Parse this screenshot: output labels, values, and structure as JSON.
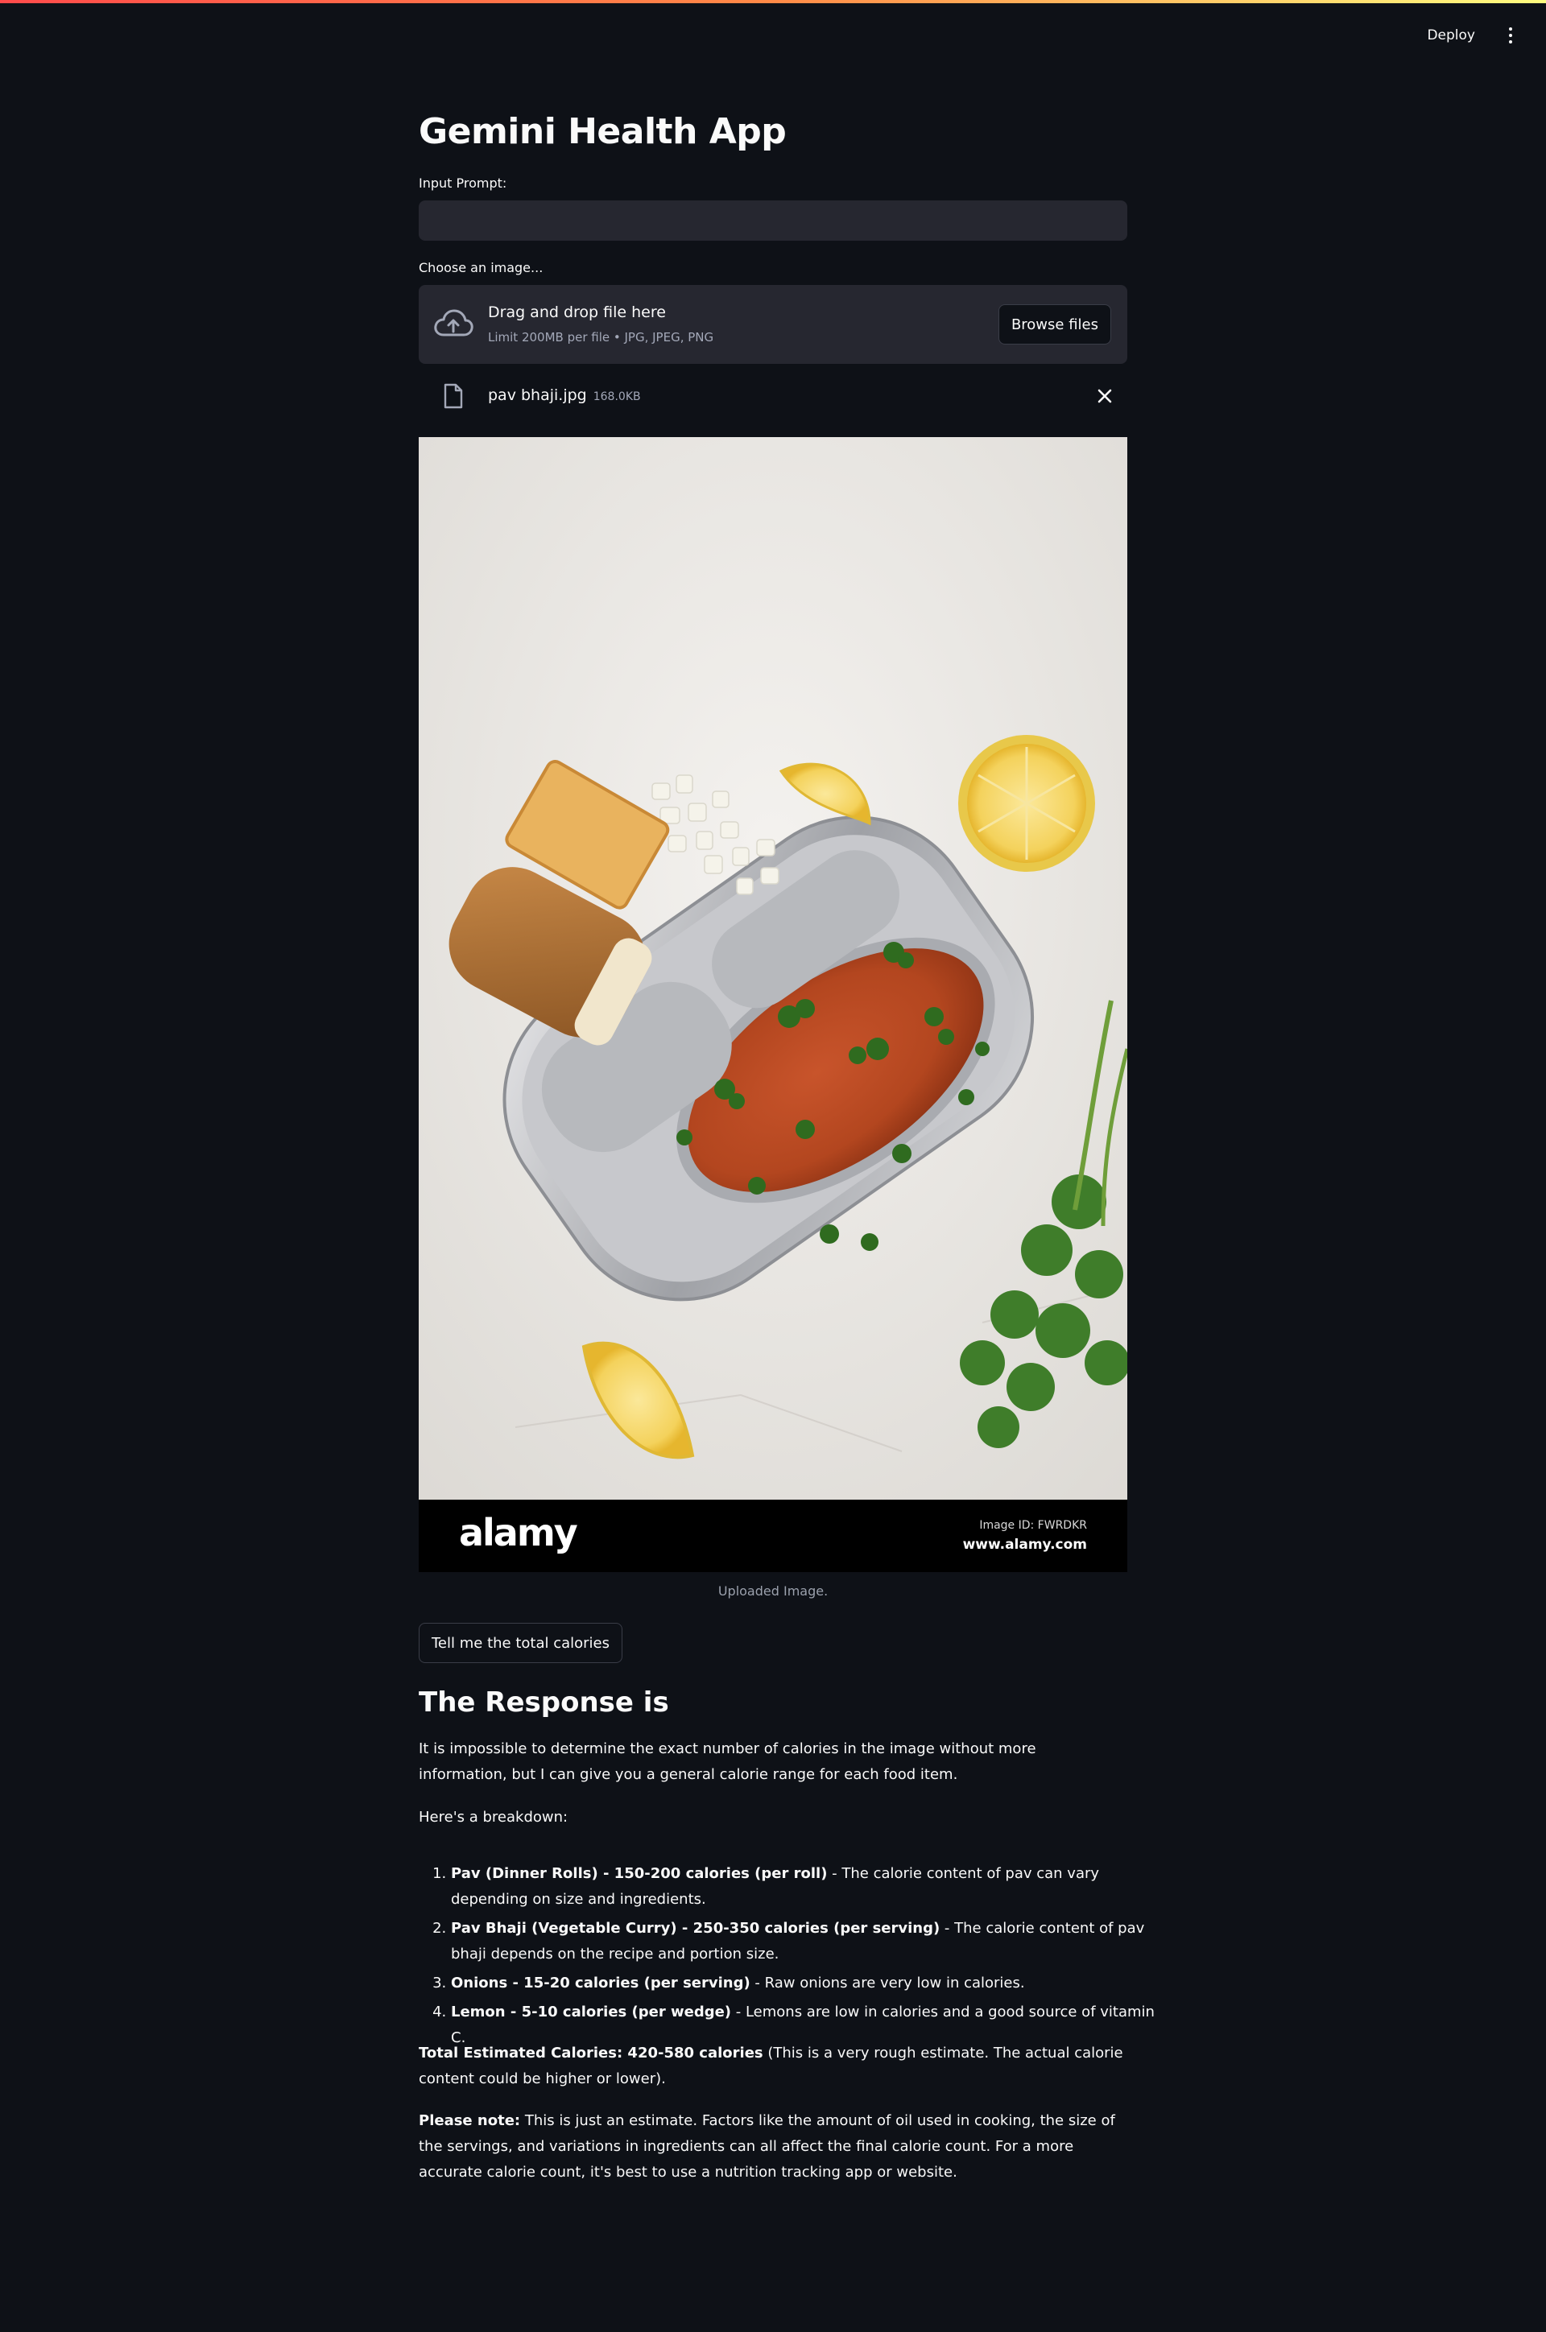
{
  "header": {
    "deploy_label": "Deploy",
    "menu_icon": "kebab-menu-icon"
  },
  "app": {
    "title": "Gemini Health App"
  },
  "prompt": {
    "label": "Input Prompt:",
    "value": ""
  },
  "uploader": {
    "label": "Choose an image...",
    "drop_title": "Drag and drop file here",
    "drop_subtitle": "Limit 200MB per file • JPG, JPEG, PNG",
    "browse_label": "Browse files",
    "upload_icon": "cloud-upload-icon"
  },
  "file": {
    "name": "pav bhaji.jpg",
    "size": "168.0KB",
    "file_icon": "file-icon",
    "remove_icon": "close-icon"
  },
  "image": {
    "watermark_logo": "alamy",
    "image_id": "Image ID: FWRDKR",
    "site": "www.alamy.com",
    "caption": "Uploaded Image."
  },
  "action": {
    "button_label": "Tell me the total calories"
  },
  "response": {
    "title": "The Response is",
    "intro": "It is impossible to determine the exact number of calories in the image without more information, but I can give you a general calorie range for each food item.",
    "breakdown_label": "Here's a breakdown:",
    "items": [
      {
        "bold": "Pav (Dinner Rolls) - 150-200 calories (per roll)",
        "rest": " - The calorie content of pav can vary depending on size and ingredients."
      },
      {
        "bold": "Pav Bhaji (Vegetable Curry) - 250-350 calories (per serving)",
        "rest": " - The calorie content of pav bhaji depends on the recipe and portion size."
      },
      {
        "bold": "Onions - 15-20 calories (per serving)",
        "rest": " - Raw onions are very low in calories."
      },
      {
        "bold": "Lemon - 5-10 calories (per wedge)",
        "rest": " - Lemons are low in calories and a good source of vitamin C."
      }
    ],
    "total_bold": "Total Estimated Calories: 420-580 calories",
    "total_rest": " (This is a very rough estimate. The actual calorie content could be higher or lower).",
    "note_bold": "Please note:",
    "note_rest": " This is just an estimate. Factors like the amount of oil used in cooking, the size of the servings, and variations in ingredients can all affect the final calorie count. For a more accurate calorie count, it's best to use a nutrition tracking app or website."
  },
  "colors": {
    "background": "#0e1117",
    "widget_bg": "#262730",
    "text": "#fafafa",
    "muted_text": "#a3a8b8",
    "accent_gradient_start": "#ff4b4b",
    "accent_gradient_end": "#fffd80"
  }
}
